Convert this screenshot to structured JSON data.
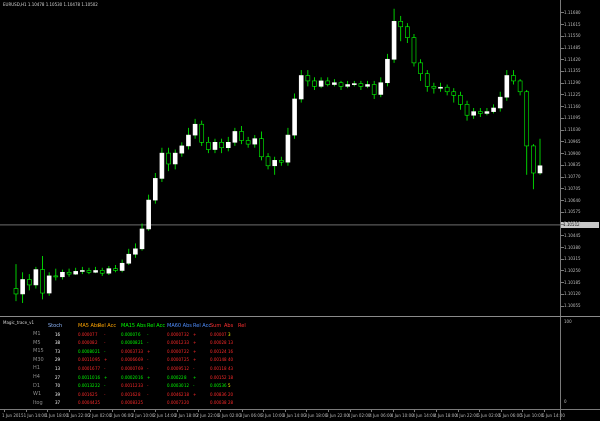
{
  "chart": {
    "title": "EURUSD,H1  1.10478 1.10530 1.10478 1.10502",
    "current_price": "1.10502",
    "colors": {
      "bull": "#ffffff",
      "bear": "#00ff00",
      "grid": "#7a7a7a",
      "hline": "#b0b0b0"
    },
    "price_labels": [
      "1.11680",
      "1.11615",
      "1.11550",
      "1.11485",
      "1.11420",
      "1.11355",
      "1.11290",
      "1.11225",
      "1.11160",
      "1.11095",
      "1.11030",
      "1.10965",
      "1.10900",
      "1.10835",
      "1.10770",
      "1.10705",
      "1.10640",
      "1.10575",
      "1.10510",
      "1.10445",
      "1.10380",
      "1.10315",
      "1.10250",
      "1.10185",
      "1.10120",
      "1.10055"
    ],
    "candles": [
      [
        1.1015,
        1.1012,
        1.10285,
        1.1008
      ],
      [
        1.1012,
        1.102,
        1.1024,
        1.1007
      ],
      [
        1.102,
        1.1017,
        1.1023,
        1.1014
      ],
      [
        1.1017,
        1.10255,
        1.1027,
        1.1015
      ],
      [
        1.10255,
        1.10125,
        1.1033,
        1.1009
      ],
      [
        1.10125,
        1.1022,
        1.1024,
        1.1011
      ],
      [
        1.1022,
        1.10215,
        1.1026,
        1.10195
      ],
      [
        1.10215,
        1.1024,
        1.10255,
        1.102
      ],
      [
        1.1024,
        1.1023,
        1.1026,
        1.10215
      ],
      [
        1.1023,
        1.10245,
        1.10265,
        1.10225
      ],
      [
        1.10245,
        1.1025,
        1.1027,
        1.1023
      ],
      [
        1.1025,
        1.1024,
        1.10265,
        1.1023
      ],
      [
        1.1024,
        1.1025,
        1.1027,
        1.10235
      ],
      [
        1.1025,
        1.10235,
        1.10265,
        1.1022
      ],
      [
        1.10235,
        1.1026,
        1.10275,
        1.10225
      ],
      [
        1.1026,
        1.1025,
        1.1028,
        1.1024
      ],
      [
        1.1025,
        1.1029,
        1.1031,
        1.1024
      ],
      [
        1.1029,
        1.1034,
        1.1037,
        1.1028
      ],
      [
        1.1034,
        1.1037,
        1.104,
        1.1032
      ],
      [
        1.1037,
        1.1048,
        1.1051,
        1.1036
      ],
      [
        1.1048,
        1.1064,
        1.1067,
        1.1047
      ],
      [
        1.1064,
        1.1076,
        1.1079,
        1.1062
      ],
      [
        1.1076,
        1.109,
        1.1093,
        1.1074
      ],
      [
        1.109,
        1.1084,
        1.1093,
        1.108
      ],
      [
        1.1084,
        1.109,
        1.1092,
        1.1081
      ],
      [
        1.109,
        1.1094,
        1.1096,
        1.1088
      ],
      [
        1.1094,
        1.11,
        1.1104,
        1.1092
      ],
      [
        1.11,
        1.1106,
        1.1109,
        1.1098
      ],
      [
        1.1106,
        1.1096,
        1.1108,
        1.1094
      ],
      [
        1.1096,
        1.1092,
        1.1099,
        1.109
      ],
      [
        1.1092,
        1.1096,
        1.1098,
        1.109
      ],
      [
        1.1096,
        1.1093,
        1.1098,
        1.109
      ],
      [
        1.1093,
        1.1096,
        1.1099,
        1.1091
      ],
      [
        1.1096,
        1.1102,
        1.1104,
        1.1094
      ],
      [
        1.1102,
        1.1097,
        1.1105,
        1.1095
      ],
      [
        1.1097,
        1.1095,
        1.1099,
        1.1093
      ],
      [
        1.1095,
        1.1098,
        1.11,
        1.1093
      ],
      [
        1.1098,
        1.1088,
        1.1102,
        1.1086
      ],
      [
        1.1088,
        1.1083,
        1.109,
        1.1081
      ],
      [
        1.1083,
        1.1086,
        1.1088,
        1.1078
      ],
      [
        1.1086,
        1.1085,
        1.1088,
        1.1083
      ],
      [
        1.1085,
        1.11,
        1.1104,
        1.1083
      ],
      [
        1.11,
        1.112,
        1.1123,
        1.1098
      ],
      [
        1.112,
        1.1133,
        1.1136,
        1.1118
      ],
      [
        1.1133,
        1.113,
        1.1136,
        1.1127
      ],
      [
        1.113,
        1.1127,
        1.1132,
        1.1125
      ],
      [
        1.1127,
        1.113,
        1.1132,
        1.1126
      ],
      [
        1.113,
        1.1128,
        1.1132,
        1.1127
      ],
      [
        1.1128,
        1.1129,
        1.1131,
        1.1127
      ],
      [
        1.1129,
        1.1127,
        1.113,
        1.1125
      ],
      [
        1.1127,
        1.1128,
        1.113,
        1.1126
      ],
      [
        1.1128,
        1.11285,
        1.113,
        1.1127
      ],
      [
        1.11285,
        1.1127,
        1.113,
        1.1125
      ],
      [
        1.1127,
        1.1128,
        1.113,
        1.1126
      ],
      [
        1.1128,
        1.11225,
        1.113,
        1.112
      ],
      [
        1.11225,
        1.1129,
        1.1132,
        1.1121
      ],
      [
        1.1129,
        1.1142,
        1.1145,
        1.1127
      ],
      [
        1.1142,
        1.1163,
        1.117,
        1.114
      ],
      [
        1.1163,
        1.116,
        1.1166,
        1.1152
      ],
      [
        1.116,
        1.1154,
        1.1162,
        1.1151
      ],
      [
        1.1154,
        1.114,
        1.1156,
        1.1138
      ],
      [
        1.114,
        1.1134,
        1.1142,
        1.113
      ],
      [
        1.1134,
        1.1127,
        1.1136,
        1.1124
      ],
      [
        1.1127,
        1.1126,
        1.1129,
        1.1123
      ],
      [
        1.1126,
        1.11265,
        1.1129,
        1.1124
      ],
      [
        1.11265,
        1.1124,
        1.1128,
        1.1122
      ],
      [
        1.1124,
        1.1122,
        1.1126,
        1.1118
      ],
      [
        1.1122,
        1.1117,
        1.1124,
        1.1114
      ],
      [
        1.1117,
        1.1111,
        1.1119,
        1.1108
      ],
      [
        1.1111,
        1.1113,
        1.1115,
        1.1109
      ],
      [
        1.1113,
        1.1112,
        1.1115,
        1.111
      ],
      [
        1.1112,
        1.1113,
        1.1115,
        1.1111
      ],
      [
        1.1113,
        1.1115,
        1.1117,
        1.1112
      ],
      [
        1.1115,
        1.1121,
        1.1124,
        1.1113
      ],
      [
        1.1121,
        1.1133,
        1.1136,
        1.1119
      ],
      [
        1.1133,
        1.113,
        1.1136,
        1.1128
      ],
      [
        1.113,
        1.1124,
        1.1131,
        1.1122
      ],
      [
        1.1124,
        1.1094,
        1.1125,
        1.1078
      ],
      [
        1.1094,
        1.1079,
        1.1095,
        1.107
      ],
      [
        1.1079,
        1.1083,
        1.1098,
        1.1078
      ]
    ],
    "time_labels": [
      "1 Jun 2015",
      "1 Jun 14:00",
      "1 Jun 18:00",
      "1 Jun 22:00",
      "2 Jun 02:00",
      "2 Jun 06:00",
      "2 Jun 10:00",
      "2 Jun 14:00",
      "2 Jun 18:00",
      "2 Jun 22:00",
      "3 Jun 02:00",
      "3 Jun 06:00",
      "3 Jun 10:00",
      "3 Jun 14:00",
      "3 Jun 18:00",
      "3 Jun 22:00",
      "4 Jun 02:00",
      "4 Jun 06:00",
      "4 Jun 10:00",
      "4 Jun 14:00",
      "4 Jun 18:00",
      "4 Jun 22:00",
      "5 Jun 02:00",
      "5 Jun 06:00",
      "5 Jun 10:00",
      "5 Jun 14:00"
    ]
  },
  "indicator": {
    "title": "Magic_trace_v1",
    "axis_labels": [
      "100",
      "0"
    ],
    "headers": [
      {
        "text": "Stoch",
        "color": "#8fb8ff"
      },
      {
        "text": "MA5 Abs",
        "color": "#ffa500"
      },
      {
        "text": "Rel Acc",
        "color": "#ffa500"
      },
      {
        "text": "MA15 Abs",
        "color": "#00ff00"
      },
      {
        "text": "Rel Acc",
        "color": "#00ff00"
      },
      {
        "text": "MA60 Abs",
        "color": "#4f8fff"
      },
      {
        "text": "Rel Acc",
        "color": "#4f8fff"
      },
      {
        "text": "Sum",
        "color": "#ff3030"
      },
      {
        "text": "Abs",
        "color": "#ff3030"
      },
      {
        "text": "Rel",
        "color": "#ff3030"
      }
    ],
    "rows": [
      {
        "tf": "M1",
        "stoch": "16",
        "c": [
          "0.00007",
          "7",
          "-",
          "0.00007",
          "6",
          "-",
          "0.00007",
          "32",
          "+",
          "0.00007",
          "3"
        ],
        "col": [
          "r",
          "r",
          "r",
          "g",
          "g",
          "g",
          "r",
          "r",
          "r",
          "r",
          "y"
        ]
      },
      {
        "tf": "M5",
        "stoch": "38",
        "c": [
          "0.00008",
          "2",
          "-",
          "0.00008",
          "21",
          "-",
          "0.00012",
          "33",
          "+",
          "0.00028",
          "13"
        ],
        "col": [
          "r",
          "r",
          "r",
          "g",
          "g",
          "g",
          "r",
          "r",
          "r",
          "r",
          "r"
        ]
      },
      {
        "tf": "M15",
        "stoch": "73",
        "c": [
          "0.00080",
          "21",
          "-",
          "0.00037",
          "33",
          "+",
          "0.00007",
          "22",
          "+",
          "0.00124",
          "16"
        ],
        "col": [
          "g",
          "g",
          "g",
          "r",
          "r",
          "r",
          "r",
          "r",
          "r",
          "r",
          "r"
        ]
      },
      {
        "tf": "M30",
        "stoch": "29",
        "c": [
          "0.00110",
          "95",
          "+",
          "0.00066",
          "69",
          "-",
          "0.00007",
          "25",
          "+",
          "0.00148",
          "40"
        ],
        "col": [
          "r",
          "r",
          "r",
          "r",
          "r",
          "r",
          "r",
          "r",
          "r",
          "r",
          "r"
        ]
      },
      {
        "tf": "H1",
        "stoch": "13",
        "c": [
          "0.00016",
          "77",
          "-",
          "0.00007",
          "69",
          "-",
          "0.00095",
          "12",
          "-",
          "0.00118",
          "43"
        ],
        "col": [
          "r",
          "r",
          "r",
          "r",
          "r",
          "r",
          "r",
          "r",
          "r",
          "r",
          "r"
        ]
      },
      {
        "tf": "H4",
        "stoch": "27",
        "c": [
          "0.00110",
          "16",
          "+",
          "0.00020",
          "16",
          "+",
          "0.00022",
          "8",
          "+",
          "0.00152",
          "18"
        ],
        "col": [
          "g",
          "g",
          "g",
          "g",
          "g",
          "g",
          "g",
          "g",
          "g",
          "r",
          "r"
        ]
      },
      {
        "tf": "D1",
        "stoch": "70",
        "c": [
          "0.00132",
          "22",
          "-",
          "0.00112",
          "33",
          "-",
          "0.00030",
          "12",
          "-",
          "0.00536",
          "5"
        ],
        "col": [
          "g",
          "g",
          "g",
          "r",
          "r",
          "r",
          "g",
          "g",
          "g",
          "g",
          "y"
        ]
      },
      {
        "tf": "W1",
        "stoch": "39",
        "c": [
          "0.00162",
          "5",
          "-",
          "0.00162",
          "8",
          "-",
          "0.00462",
          "18",
          "+",
          "0.00836",
          "20"
        ],
        "col": [
          "r",
          "r",
          "r",
          "r",
          "r",
          "r",
          "r",
          "r",
          "r",
          "r",
          "r"
        ]
      },
      {
        "tf": "Itog",
        "stoch": "37",
        "c": [
          "0.00044",
          "25",
          "",
          "0.00083",
          "25",
          "",
          "0.00073",
          "20",
          "",
          "0.00038",
          "28"
        ],
        "col": [
          "r",
          "r",
          "r",
          "r",
          "r",
          "r",
          "r",
          "r",
          "r",
          "r",
          "r"
        ]
      }
    ]
  }
}
